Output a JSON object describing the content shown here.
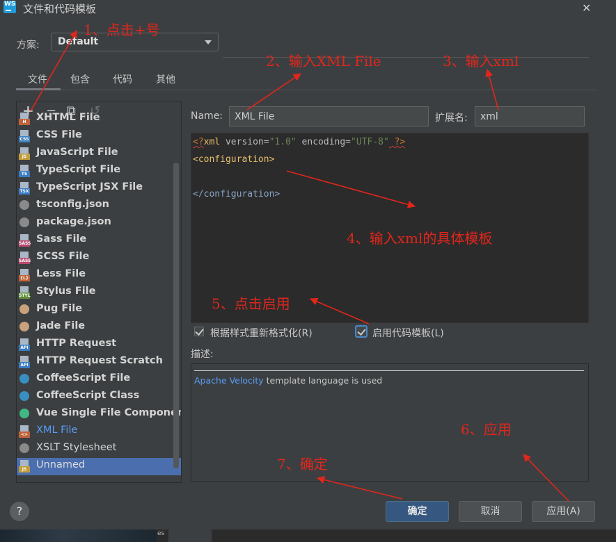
{
  "window": {
    "title": "文件和代码模板",
    "app_badge": "WS"
  },
  "scheme": {
    "label": "方案:",
    "value": "Default"
  },
  "tabs": [
    {
      "label": "文件"
    },
    {
      "label": "包含"
    },
    {
      "label": "代码"
    },
    {
      "label": "其他"
    }
  ],
  "toolbar": {
    "add": "+",
    "remove": "−",
    "copy": "⧉",
    "reset": "↺"
  },
  "file_list": [
    {
      "label": "XHTML File",
      "icon": "html-icon",
      "tag": "H",
      "color": "#c1633a"
    },
    {
      "label": "CSS File",
      "icon": "css-icon",
      "tag": "CSS",
      "color": "#3f7fbf"
    },
    {
      "label": "JavaScript File",
      "icon": "javascript-icon",
      "tag": "JS",
      "color": "#c29d3a"
    },
    {
      "label": "TypeScript File",
      "icon": "typescript-icon",
      "tag": "TS",
      "color": "#3a7cc2"
    },
    {
      "label": "TypeScript JSX File",
      "icon": "tsx-icon",
      "tag": "TSX",
      "color": "#3a7cc2"
    },
    {
      "label": "tsconfig.json",
      "icon": "tsconfig-icon",
      "tag": "",
      "color": "#8a8a8a"
    },
    {
      "label": "package.json",
      "icon": "package-json-icon",
      "tag": "",
      "color": "#8a8a8a"
    },
    {
      "label": "Sass File",
      "icon": "sass-icon",
      "tag": "SASS",
      "color": "#b9496e"
    },
    {
      "label": "SCSS File",
      "icon": "scss-icon",
      "tag": "SASS",
      "color": "#b9496e"
    },
    {
      "label": "Less File",
      "icon": "less-icon",
      "tag": "{L}",
      "color": "#c1633a"
    },
    {
      "label": "Stylus File",
      "icon": "stylus-icon",
      "tag": "STYL",
      "color": "#5f8f3a"
    },
    {
      "label": "Pug File",
      "icon": "pug-icon",
      "tag": "",
      "color": "#c9a27b"
    },
    {
      "label": "Jade File",
      "icon": "jade-icon",
      "tag": "",
      "color": "#c9a27b"
    },
    {
      "label": "HTTP Request",
      "icon": "api-icon",
      "tag": "API",
      "color": "#3a7cc2"
    },
    {
      "label": "HTTP Request Scratch",
      "icon": "api-scratch-icon",
      "tag": "API",
      "color": "#3a7cc2"
    },
    {
      "label": "CoffeeScript File",
      "icon": "coffeescript-icon",
      "tag": "",
      "color": "#3a8fc2"
    },
    {
      "label": "CoffeeScript Class",
      "icon": "coffeescript-class-icon",
      "tag": "",
      "color": "#3a8fc2"
    },
    {
      "label": "Vue Single File Component",
      "icon": "vue-icon",
      "tag": "",
      "color": "#41b883"
    },
    {
      "label": "XML File",
      "icon": "xml-icon",
      "tag": "<>",
      "color": "#c1633a"
    },
    {
      "label": "XSLT Stylesheet",
      "icon": "xslt-icon",
      "tag": "",
      "color": "#8a8a8a"
    },
    {
      "label": "Unnamed",
      "icon": "javascript-icon",
      "tag": "JS",
      "color": "#c29d3a"
    }
  ],
  "form": {
    "name_label": "Name:",
    "name_value": "XML File",
    "ext_label": "扩展名:",
    "ext_value": "xml"
  },
  "editor": {
    "line1": {
      "pi_open": "<?",
      "tag": "xml",
      "attr1": " version=",
      "val1": "\"1.0\"",
      "attr2": " encoding=",
      "val2": "\"UTF-8\"",
      "pi_close": " ?>"
    },
    "line2": "<configuration>",
    "line4": "</configuration>"
  },
  "options": {
    "reformat_label": "根据样式重新格式化(R)",
    "reformat_checked": true,
    "enable_live_label": "启用代码模板(L)",
    "enable_live_checked": true
  },
  "description": {
    "label": "描述:",
    "link": "Apache Velocity",
    "text": " template language is used"
  },
  "buttons": {
    "help": "?",
    "ok": "确定",
    "cancel": "取消",
    "apply": "应用(A)"
  },
  "bottom": {
    "side_text": "es"
  },
  "annotations": [
    "1、点击+号",
    "2、输入XML File",
    "3、输入xml",
    "4、输入xml的具体模板",
    "5、点击启用",
    "6、应用",
    "7、确定"
  ],
  "colors": {
    "accent": "#4b6eaf",
    "annotation": "#e1261c",
    "background": "#3c3f41",
    "editor_bg": "#2b2b2b"
  }
}
